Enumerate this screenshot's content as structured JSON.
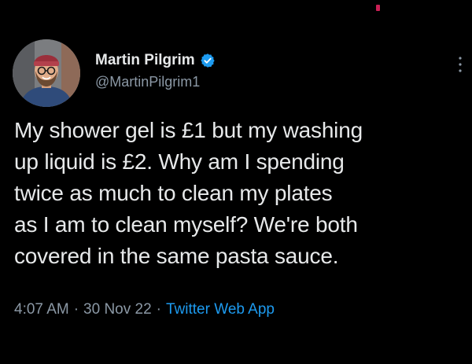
{
  "colors": {
    "background": "#000000",
    "primary_text": "#e7e9ea",
    "secondary_text": "#8b98a5",
    "link": "#1d9bf0",
    "verified": "#1d9bf0"
  },
  "author": {
    "display_name": "Martin Pilgrim",
    "handle": "@MartinPilgrim1",
    "verified_icon": "verified-badge-icon",
    "avatar_icon": "profile-photo"
  },
  "tweet": {
    "text": "My shower gel is £1 but my washing\nup liquid is £2. Why am I spending\ntwice as much to clean my plates\nas I am to clean myself? We're both\ncovered in the same pasta sauce."
  },
  "meta": {
    "time": "4:07 AM",
    "separator": "·",
    "date": "30 Nov 22",
    "client": "Twitter Web App"
  },
  "menu": {
    "icon": "more-vertical-icon"
  }
}
